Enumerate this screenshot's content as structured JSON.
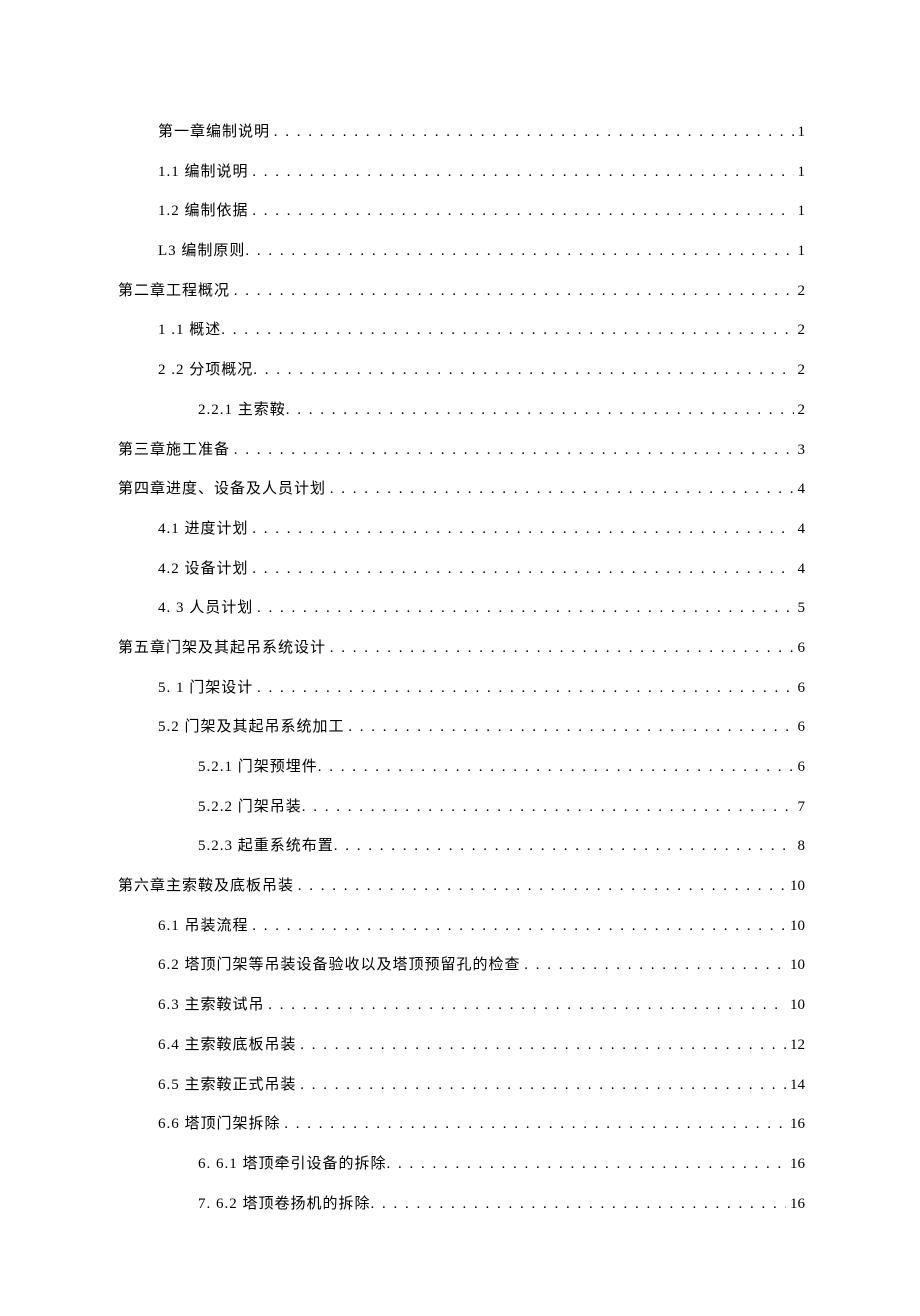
{
  "toc": [
    {
      "label": "第一章编制说明",
      "page": "1",
      "indent": 1,
      "gap": true
    },
    {
      "label": "1.1 编制说明",
      "page": "1",
      "indent": 1,
      "gap": true
    },
    {
      "label": "1.2 编制依据",
      "page": "1",
      "indent": 1,
      "gap": true
    },
    {
      "label": "L3 编制原则",
      "page": "1",
      "indent": 1,
      "gap": false
    },
    {
      "label": "第二章工程概况",
      "page": "2",
      "indent": 0,
      "gap": true
    },
    {
      "label": "1  .1 概述",
      "page": "2",
      "indent": 1,
      "gap": false
    },
    {
      "label": "2  .2 分项概况",
      "page": "2",
      "indent": 1,
      "gap": false
    },
    {
      "label": "2.2.1 主索鞍",
      "page": "2",
      "indent": 2,
      "gap": false
    },
    {
      "label": "第三章施工准备",
      "page": "3",
      "indent": 0,
      "gap": true
    },
    {
      "label": "第四章进度、设备及人员计划",
      "page": "4",
      "indent": 0,
      "gap": true
    },
    {
      "label": "4.1 进度计划",
      "page": "4",
      "indent": 1,
      "gap": true
    },
    {
      "label": "4.2 设备计划",
      "page": "4",
      "indent": 1,
      "gap": true
    },
    {
      "label": "4.  3 人员计划",
      "page": "5",
      "indent": 1,
      "gap": true
    },
    {
      "label": "第五章门架及其起吊系统设计",
      "page": "6",
      "indent": 0,
      "gap": true
    },
    {
      "label": "5.  1 门架设计",
      "page": "6",
      "indent": 1,
      "gap": true
    },
    {
      "label": "5.2 门架及其起吊系统加工",
      "page": "6",
      "indent": 1,
      "gap": true
    },
    {
      "label": "5.2.1 门架预埋件",
      "page": "6",
      "indent": 2,
      "gap": false
    },
    {
      "label": "5.2.2 门架吊装",
      "page": "7",
      "indent": 2,
      "gap": false
    },
    {
      "label": "5.2.3 起重系统布置",
      "page": "8",
      "indent": 2,
      "gap": false
    },
    {
      "label": "第六章主索鞍及底板吊装",
      "page": "10",
      "indent": 0,
      "gap": true
    },
    {
      "label": "6.1 吊装流程",
      "page": "10",
      "indent": 1,
      "gap": true
    },
    {
      "label": "6.2 塔顶门架等吊装设备验收以及塔顶预留孔的检查",
      "page": "10",
      "indent": 1,
      "gap": true
    },
    {
      "label": "6.3 主索鞍试吊",
      "page": "10",
      "indent": 1,
      "gap": true
    },
    {
      "label": "6.4 主索鞍底板吊装",
      "page": "12",
      "indent": 1,
      "gap": true
    },
    {
      "label": "6.5 主索鞍正式吊装",
      "page": "14",
      "indent": 1,
      "gap": true
    },
    {
      "label": "6.6 塔顶门架拆除",
      "page": "16",
      "indent": 1,
      "gap": true
    },
    {
      "label": "6.  6.1 塔顶牵引设备的拆除",
      "page": "16",
      "indent": 2,
      "gap": false
    },
    {
      "label": "7.  6.2 塔顶卷扬机的拆除",
      "page": "16",
      "indent": 2,
      "gap": false
    }
  ]
}
